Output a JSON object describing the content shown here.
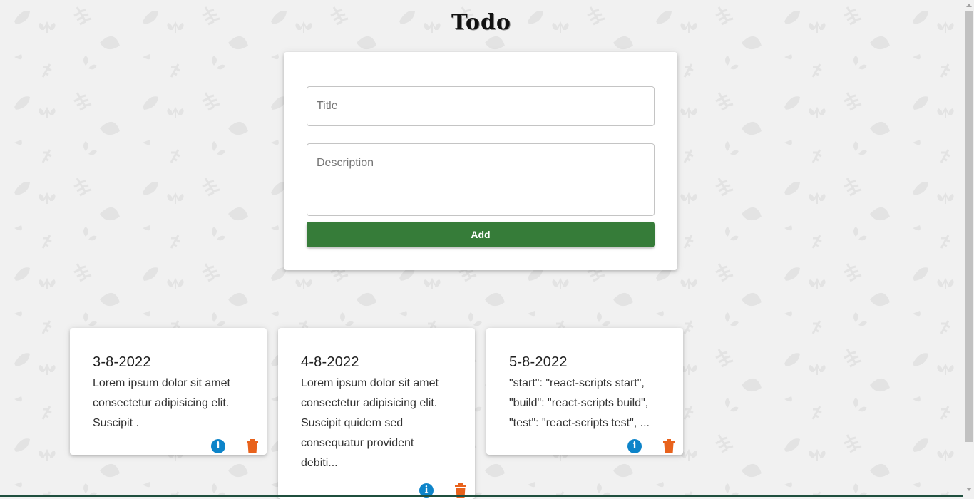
{
  "app": {
    "title": "Todo"
  },
  "form": {
    "title_placeholder": "Title",
    "description_placeholder": "Description",
    "add_label": "Add"
  },
  "todos": [
    {
      "title": "3-8-2022",
      "description": "Lorem ipsum dolor sit amet consectetur adipisicing elit. Suscipit ."
    },
    {
      "title": "4-8-2022",
      "description": "Lorem ipsum dolor sit amet consectetur adipisicing elit. Suscipit quidem sed consequatur provident debiti..."
    },
    {
      "title": "5-8-2022",
      "description": "\"start\": \"react-scripts start\", \"build\": \"react-scripts build\", \"test\": \"react-scripts test\", ..."
    }
  ],
  "icons": {
    "info": "info-icon",
    "delete": "trash-icon"
  },
  "colors": {
    "add_button": "#367c39",
    "info": "#0d84c9",
    "delete": "#e8621c",
    "background": "#f1f1f1"
  }
}
